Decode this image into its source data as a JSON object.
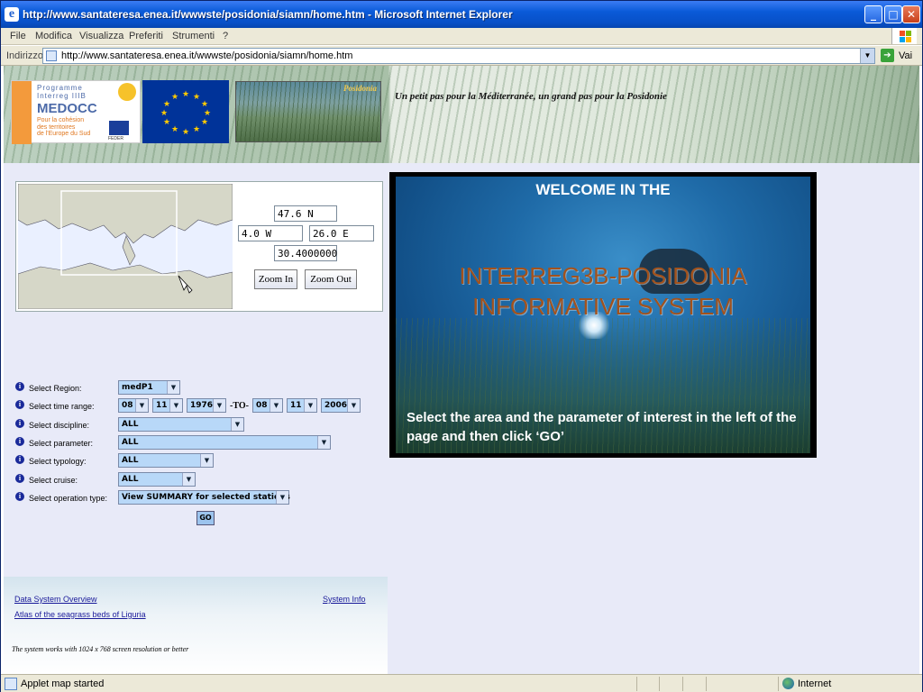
{
  "window": {
    "title": "http://www.santateresa.enea.it/wwwste/posidonia/siamn/home.htm - Microsoft Internet Explorer",
    "minimize": "_",
    "maximize": "□",
    "close": "✕"
  },
  "menu": [
    "File",
    "Modifica",
    "Visualizza",
    "Preferiti",
    "Strumenti",
    "?"
  ],
  "address": {
    "label": "Indirizzo",
    "url": "http://www.santateresa.enea.it/wwwste/posidonia/siamn/home.htm",
    "go_label": "Vai"
  },
  "banner": {
    "medocc_line1": "Programme",
    "medocc_line2": "Interreg IIIB",
    "medocc_name": "MEDOCC",
    "medocc_tag1": "Pour la cohésion",
    "medocc_tag2": "des territoires",
    "medocc_tag3": "de l'Europe du Sud",
    "feder": "FEDER",
    "posidonia_label": "Posidonia",
    "slogan": "Un petit pas pour la Méditerranée, un grand pas pour la Posidonie"
  },
  "map": {
    "north": "47.6 N",
    "west": "4.0 W",
    "east": "26.0 E",
    "scale": "30.4000000",
    "zoom_in": "Zoom In",
    "zoom_out": "Zoom Out"
  },
  "form": {
    "region_label": "Select Region:",
    "region_value": "medP1",
    "time_label": "Select time range:",
    "from_day": "08",
    "from_month": "11",
    "from_year": "1976",
    "to_sep": "-TO-",
    "to_day": "08",
    "to_month": "11",
    "to_year": "2006",
    "discipline_label": "Select discipline:",
    "discipline_value": "ALL",
    "parameter_label": "Select parameter:",
    "parameter_value": "ALL",
    "typology_label": "Select typology:",
    "typology_value": "ALL",
    "cruise_label": "Select cruise:",
    "cruise_value": "ALL",
    "operation_label": "Select operation type:",
    "operation_value": "View SUMMARY for selected stations",
    "go_button": "GO"
  },
  "footer": {
    "overview_link": "Data System Overview",
    "info_link": "System Info",
    "atlas_link": "Atlas of the seagrass beds of Liguria",
    "note": "The system works with 1024 x 768 screen resolution or better"
  },
  "welcome": {
    "line1": "WELCOME  IN THE",
    "line2": "INTERREG3B-POSIDONIA",
    "line3": "INFORMATIVE SYSTEM",
    "instructions": "Select the area and the parameter of interest in the left of the page and then  click ‘GO’"
  },
  "status": {
    "text": "Applet map started",
    "zone": "Internet"
  }
}
